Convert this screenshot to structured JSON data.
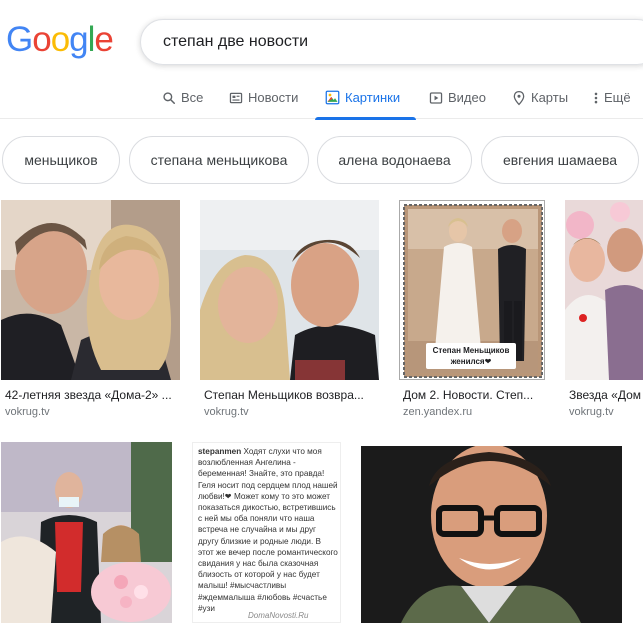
{
  "logo": {
    "letters": [
      "G",
      "o",
      "o",
      "g",
      "l",
      "e"
    ],
    "colors": [
      "#4285F4",
      "#EA4335",
      "#FBBC05",
      "#4285F4",
      "#34A853",
      "#EA4335"
    ]
  },
  "search": {
    "query": "степан две новости"
  },
  "tabs": [
    {
      "label": "Все",
      "icon": "search-icon"
    },
    {
      "label": "Новости",
      "icon": "news-icon"
    },
    {
      "label": "Картинки",
      "icon": "image-icon",
      "active": true
    },
    {
      "label": "Видео",
      "icon": "video-icon"
    },
    {
      "label": "Карты",
      "icon": "location-pin-icon"
    },
    {
      "label": "Ещё",
      "icon": "more-vertical-icon"
    }
  ],
  "chips": [
    "меньщиков",
    "степана меньщикова",
    "алена водонаева",
    "евгения шамаева"
  ],
  "results": [
    {
      "caption": "42-летняя звезда «Дома-2» ...",
      "source": "vokrug.tv"
    },
    {
      "caption": "Степан Меньщиков возвра...",
      "source": "vokrug.tv"
    },
    {
      "caption": "Дом 2. Новости. Степ...",
      "source": "zen.yandex.ru",
      "overlay": "Степан Меньщиков женился❤"
    },
    {
      "caption": "Звезда «Дом",
      "source": "vokrug.tv"
    }
  ],
  "post": {
    "username": "stepanmen",
    "text": "Ходят слухи что моя возлюбленная Ангелина - беременная! Знайте, это правда! Геля носит под сердцем плод нашей любви!❤ Может кому то это может показаться дикостью, встретившись с ней мы оба поняли что наша встреча не случайна и мы друг другу близкие и родные люди. В этот же вечер после романтического свидания у нас была сказочная близость от которой у нас будет малыш!",
    "tags": "#мысчастливы #ждеммалыша #любовь #счастье #узи",
    "watermark": "DomaNovosti.Ru"
  },
  "colors": {
    "accent": "#1a73e8",
    "tab_text": "#5f6368",
    "source_text": "#70757a"
  }
}
